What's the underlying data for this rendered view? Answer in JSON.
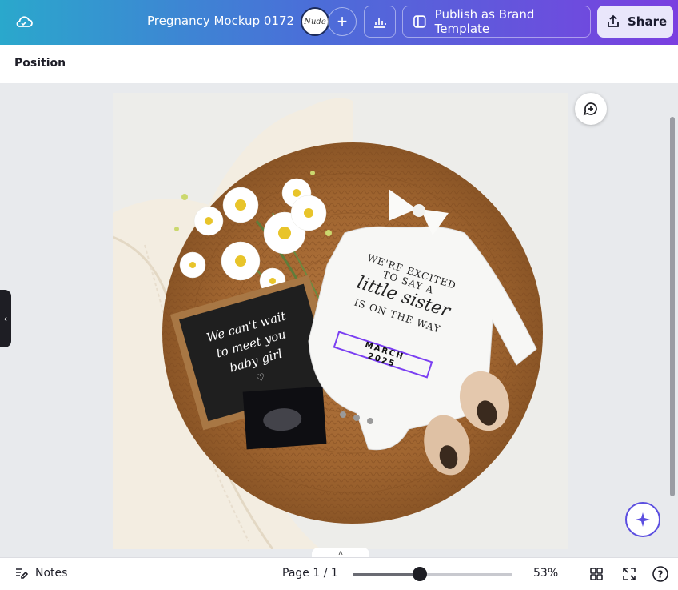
{
  "header": {
    "title": "Pregnancy Mockup 0172",
    "avatar_text": "Nude",
    "plus_label": "+",
    "publish_label": "Publish as Brand Template",
    "share_label": "Share"
  },
  "context_toolbar": {
    "position_label": "Position"
  },
  "design": {
    "letterboard_lines": [
      "We can't wait",
      "to meet you",
      "baby girl"
    ],
    "onesie_line1": "WE'RE EXCITED",
    "onesie_line2": "TO SAY A",
    "onesie_script": "little sister",
    "onesie_line3": "IS ON THE WAY",
    "month": "MARCH",
    "year": "2025",
    "selection_color": "#7b3ff2"
  },
  "footer": {
    "notes_label": "Notes",
    "page_label": "Page 1 / 1",
    "zoom_label": "53%",
    "zoom_fraction": 0.42,
    "help_label": "?"
  },
  "icons": [
    "cloud-sync-icon",
    "insights-icon",
    "publish-template-icon",
    "share-upload-icon",
    "comment-add-icon",
    "magic-sparkle-icon",
    "notes-icon",
    "grid-view-icon",
    "fullscreen-icon",
    "help-icon",
    "chevron-left-icon",
    "chevron-up-icon"
  ],
  "colors": {
    "accent": "#7b3ff2",
    "header_start": "#2aa8cc",
    "header_end": "#7a3fe0"
  }
}
